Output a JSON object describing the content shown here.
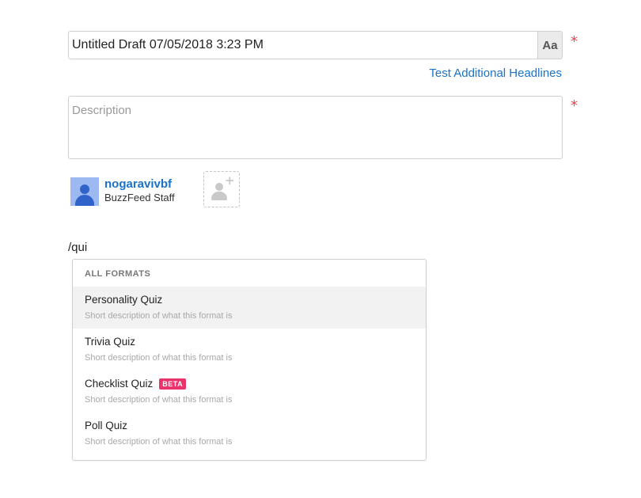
{
  "headline": {
    "value": "Untitled Draft 07/05/2018 3:23 PM",
    "font_button_label": "Aa",
    "required_marker": "*"
  },
  "test_headlines_link": "Test Additional Headlines",
  "description": {
    "placeholder": "Description",
    "value": "",
    "required_marker": "*"
  },
  "author": {
    "username": "nogaravivbf",
    "role": "BuzzFeed Staff",
    "add_icon_plus": "+"
  },
  "slash_command": "/qui",
  "formats_menu": {
    "header": "ALL FORMATS",
    "items": [
      {
        "title": "Personality Quiz",
        "description": "Short description of what this format is",
        "badge": ""
      },
      {
        "title": "Trivia Quiz",
        "description": "Short description of what this format is",
        "badge": ""
      },
      {
        "title": "Checklist Quiz",
        "description": "Short description of what this format is",
        "badge": "BETA"
      },
      {
        "title": "Poll Quiz",
        "description": "Short description of what this format is",
        "badge": ""
      }
    ],
    "highlighted_index": 0
  },
  "colors": {
    "link": "#1a73c9",
    "required": "#e0444b",
    "beta_badge": "#e8336b",
    "avatar_bg": "#9cb9f2",
    "highlight_row": "#f2f2f2"
  }
}
